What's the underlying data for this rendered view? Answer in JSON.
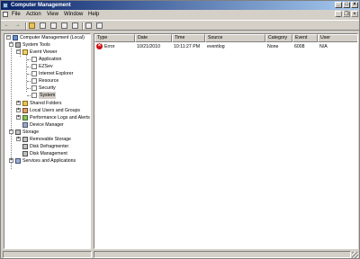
{
  "window": {
    "title": "Computer Management"
  },
  "title_buttons": {
    "minimize": "_",
    "maximize": "□",
    "close": "×"
  },
  "menu": [
    "File",
    "Action",
    "View",
    "Window",
    "Help"
  ],
  "mdi_buttons": {
    "minimize": "_",
    "restore": "❐",
    "close": "×"
  },
  "toolbar": {
    "icons": [
      "back-icon",
      "forward-icon",
      "up-icon",
      "show-hide-tree-icon",
      "properties-icon",
      "refresh-icon",
      "export-icon",
      "help-icon",
      "show-hide-console-icon"
    ],
    "back": "←",
    "forward": "→"
  },
  "tree": {
    "root": "Computer Management (Local)",
    "system_tools": "System Tools",
    "event_viewer": "Event Viewer",
    "logs": [
      "Application",
      "EZSev",
      "Internet Explorer",
      "Resource",
      "Security",
      "System"
    ],
    "shared_folders": "Shared Folders",
    "local_users": "Local Users and Groups",
    "perf_logs": "Performance Logs and Alerts",
    "device_manager": "Device Manager",
    "storage": "Storage",
    "removable_storage": "Removable Storage",
    "disk_defrag": "Disk Defragmenter",
    "disk_mgmt": "Disk Management",
    "services": "Services and Applications",
    "expand_plus": "+",
    "expand_minus": "−"
  },
  "list": {
    "columns": [
      "Type",
      "Date",
      "Time",
      "Source",
      "Category",
      "Event",
      "User"
    ],
    "rows": [
      {
        "type": "Error",
        "date": "10/21/2010",
        "time": "10:11:27 PM",
        "source": "eventlog",
        "category": "None",
        "event": "6008",
        "user": "N/A"
      }
    ],
    "error_glyph": "×"
  }
}
